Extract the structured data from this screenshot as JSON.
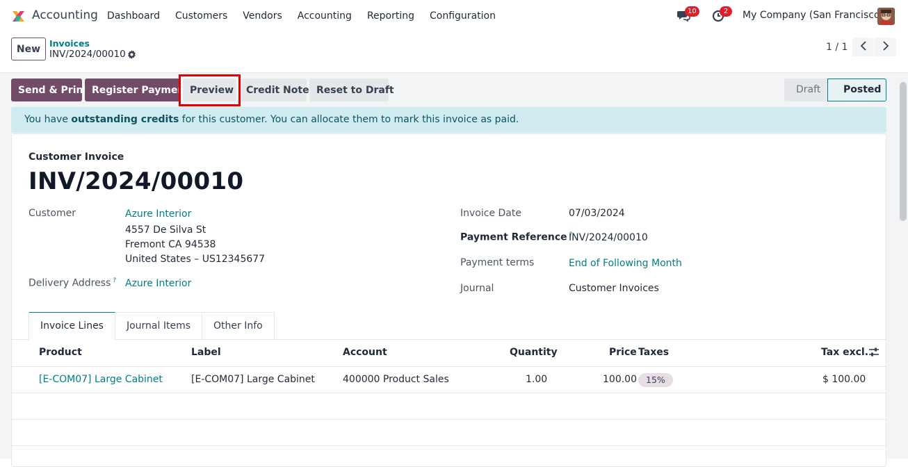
{
  "app": {
    "name": "Accounting",
    "menu": [
      "Dashboard",
      "Customers",
      "Vendors",
      "Accounting",
      "Reporting",
      "Configuration"
    ],
    "messages_count": "10",
    "activities_count": "2",
    "company": "My Company (San Francisco)"
  },
  "control": {
    "new_label": "New",
    "breadcrumb_parent": "Invoices",
    "breadcrumb_current": "INV/2024/00010",
    "pager": "1 / 1"
  },
  "actions": {
    "send_print": "Send & Print",
    "register_payment": "Register Payment",
    "preview": "Preview",
    "credit_note": "Credit Note",
    "reset_to_draft": "Reset to Draft"
  },
  "status": {
    "draft": "Draft",
    "posted": "Posted"
  },
  "alert": {
    "prefix": "You have ",
    "bold": "outstanding credits",
    "suffix": " for this customer. You can allocate them to mark this invoice as paid."
  },
  "invoice": {
    "type_label": "Customer Invoice",
    "number": "INV/2024/00010",
    "customer_label": "Customer",
    "customer_name": "Azure Interior",
    "address_line1": "4557 De Silva St",
    "address_line2": "Fremont CA 94538",
    "address_line3": "United States – US12345677",
    "delivery_label": "Delivery Address",
    "delivery_value": "Azure Interior",
    "invoice_date_label": "Invoice Date",
    "invoice_date": "07/03/2024",
    "payment_ref_label": "Payment Reference",
    "payment_ref": "INV/2024/00010",
    "payment_terms_label": "Payment terms",
    "payment_terms": "End of Following Month",
    "journal_label": "Journal",
    "journal": "Customer Invoices",
    "help_mark": "?"
  },
  "tabs": [
    "Invoice Lines",
    "Journal Items",
    "Other Info"
  ],
  "table": {
    "headers": {
      "product": "Product",
      "label": "Label",
      "account": "Account",
      "quantity": "Quantity",
      "price": "Price",
      "taxes": "Taxes",
      "tax_excl": "Tax excl."
    },
    "rows": [
      {
        "product": "[E-COM07] Large Cabinet",
        "label": "[E-COM07] Large Cabinet",
        "account": "400000 Product Sales",
        "quantity": "1.00",
        "price": "100.00",
        "taxes": "15%",
        "tax_excl": "$ 100.00"
      }
    ]
  },
  "colors": {
    "brand": "#714b67",
    "link": "#017e84",
    "alert_bg": "#d1ecf1",
    "highlight": "#e00000"
  }
}
